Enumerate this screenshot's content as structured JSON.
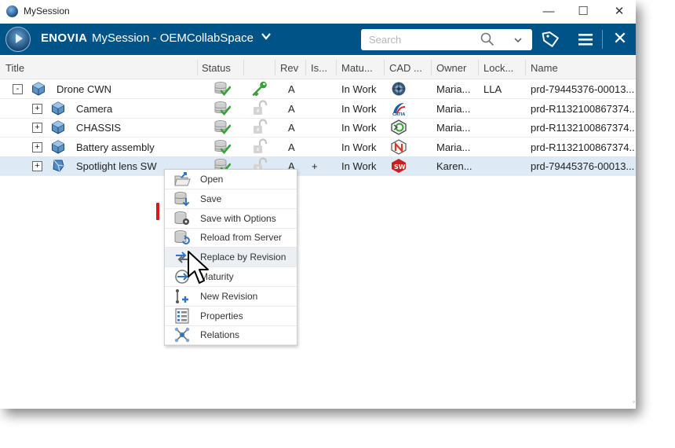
{
  "os_window": {
    "title": "MySession",
    "minimize": "—",
    "maximize": "☐",
    "close": "✕"
  },
  "header": {
    "brand": "ENOVIA",
    "session_title": "MySession - OEMCollabSpace",
    "session_chevron": "❯",
    "search_placeholder": "Search",
    "close_glyph": "✕"
  },
  "table": {
    "columns": [
      "Title",
      "Status",
      "Rev",
      "Is...",
      "Matu...",
      "CAD ...",
      "Owner",
      "Lock...",
      "Name"
    ],
    "rows": [
      {
        "expander": "-",
        "title": "Drone CWN",
        "rev": "A",
        "is": "",
        "maturity": "In Work",
        "owner": "Maria...",
        "lock": "LLA",
        "name": "prd-79445376-00013...",
        "lock_icon": "key-icon",
        "cad_icon": "assembly-cad-icon"
      },
      {
        "expander": "+",
        "title": "Camera",
        "rev": "A",
        "is": "",
        "maturity": "In Work",
        "owner": "Maria...",
        "lock": "",
        "name": "prd-R1132100867374...",
        "lock_icon": "unlocked-icon",
        "cad_icon": "catia-icon"
      },
      {
        "expander": "+",
        "title": "CHASSIS",
        "rev": "A",
        "is": "",
        "maturity": "In Work",
        "owner": "Maria...",
        "lock": "",
        "name": "prd-R1132100867374...",
        "lock_icon": "unlocked-icon",
        "cad_icon": "creo-icon"
      },
      {
        "expander": "+",
        "title": "Battery assembly",
        "rev": "A",
        "is": "",
        "maturity": "In Work",
        "owner": "Maria...",
        "lock": "",
        "name": "prd-R1132100867374...",
        "lock_icon": "unlocked-icon",
        "cad_icon": "nx-icon"
      },
      {
        "expander": "+",
        "title": "Spotlight lens SW",
        "rev": "A",
        "is": "+",
        "maturity": "In Work",
        "owner": "Karen...",
        "lock": "",
        "name": "prd-79445376-00013...",
        "lock_icon": "unlocked-icon",
        "cad_icon": "solidworks-icon"
      }
    ]
  },
  "context_menu": {
    "items": [
      {
        "label": "Open",
        "icon": "open-icon"
      },
      {
        "label": "Save",
        "icon": "save-icon"
      },
      {
        "label": "Save with Options",
        "icon": "save-options-icon"
      },
      {
        "label": "Reload from Server",
        "icon": "reload-icon"
      },
      {
        "label": "Replace by Revision",
        "icon": "replace-revision-icon"
      },
      {
        "label": "Maturity",
        "icon": "maturity-icon"
      },
      {
        "label": "New Revision",
        "icon": "new-revision-icon"
      },
      {
        "label": "Properties",
        "icon": "properties-icon"
      },
      {
        "label": "Relations",
        "icon": "relations-icon"
      }
    ],
    "highlighted": "Replace by Revision"
  },
  "colors": {
    "header_bg": "#005386",
    "selected_row": "#dde9f5",
    "status_green": "#3aa13a",
    "key_green": "#3aa13a",
    "marker_red": "#e01515"
  }
}
